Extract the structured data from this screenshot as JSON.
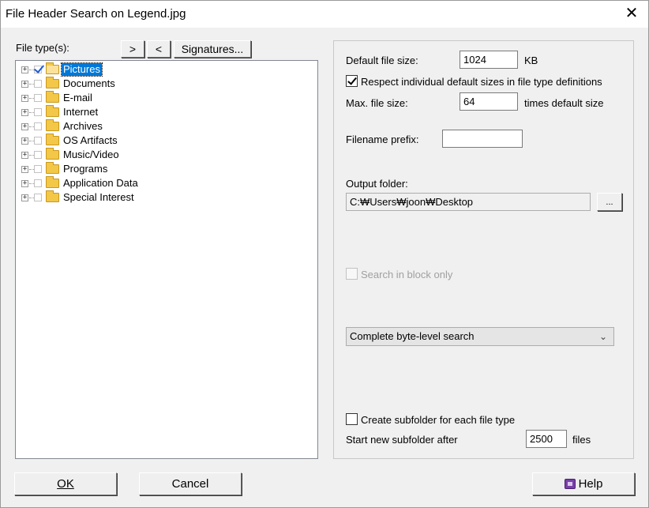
{
  "window": {
    "title": "File Header Search on Legend.jpg",
    "close_glyph": "✕"
  },
  "left": {
    "file_types_label": "File type(s):",
    "btn_expand": ">",
    "btn_collapse": "<",
    "btn_signatures": "Signatures...",
    "tree": [
      {
        "label": "Pictures",
        "checked": true,
        "selected": true
      },
      {
        "label": "Documents",
        "checked": false
      },
      {
        "label": "E-mail",
        "checked": false
      },
      {
        "label": "Internet",
        "checked": false
      },
      {
        "label": "Archives",
        "checked": false
      },
      {
        "label": "OS Artifacts",
        "checked": false
      },
      {
        "label": "Music/Video",
        "checked": false
      },
      {
        "label": "Programs",
        "checked": false
      },
      {
        "label": "Application Data",
        "checked": false
      },
      {
        "label": "Special Interest",
        "checked": false
      }
    ],
    "expander_glyph": "+"
  },
  "right": {
    "default_size_label": "Default file size:",
    "default_size_value": "1024",
    "default_size_unit": "KB",
    "respect_label": "Respect individual default sizes in file type definitions",
    "respect_checked": true,
    "max_size_label": "Max. file size:",
    "max_size_value": "64",
    "max_size_unit": "times default size",
    "prefix_label": "Filename prefix:",
    "prefix_value": "",
    "output_label": "Output folder:",
    "output_value": "C:₩Users₩joon₩Desktop",
    "browse_label": "...",
    "block_only_label": "Search in block only",
    "block_only_checked": false,
    "search_mode": "Complete byte-level search",
    "subfolder_label": "Create subfolder for each file type",
    "subfolder_checked": false,
    "start_new_label": "Start new subfolder after",
    "start_new_value": "2500",
    "start_new_unit": "files"
  },
  "footer": {
    "ok": "OK",
    "cancel": "Cancel",
    "help": "Help"
  },
  "icons": {
    "close": "close-icon",
    "folder": "folder-icon",
    "help": "help-book-icon",
    "dropdown": "chevron-down-icon"
  }
}
